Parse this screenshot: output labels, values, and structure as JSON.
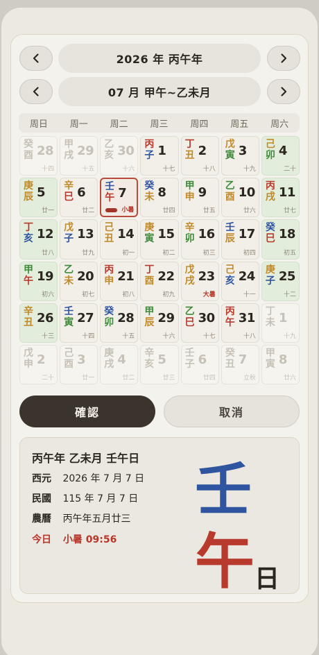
{
  "year_nav": {
    "title": "2026 年 丙午年"
  },
  "month_nav": {
    "title": "07 月 甲午~乙未月"
  },
  "weekdays": [
    "周日",
    "周一",
    "周二",
    "周三",
    "周四",
    "周五",
    "周六"
  ],
  "colors": {
    "wood": "#3f8a3a",
    "fire": "#b83a2c",
    "earth": "#c08a2a",
    "metal": "#a39a86",
    "water": "#2f55a0"
  },
  "days": [
    {
      "s": "癸",
      "b": "酉",
      "d": "28",
      "l": "十四",
      "muted": true
    },
    {
      "s": "甲",
      "b": "戌",
      "d": "29",
      "l": "十五",
      "muted": true
    },
    {
      "s": "乙",
      "b": "亥",
      "d": "30",
      "l": "十六",
      "muted": true
    },
    {
      "s": "丙",
      "b": "子",
      "d": "1",
      "l": "十七",
      "sc": "fire",
      "bc": "water"
    },
    {
      "s": "丁",
      "b": "丑",
      "d": "2",
      "l": "十八",
      "sc": "fire",
      "bc": "earth"
    },
    {
      "s": "戊",
      "b": "寅",
      "d": "3",
      "l": "十九",
      "sc": "earth",
      "bc": "wood"
    },
    {
      "s": "己",
      "b": "卯",
      "d": "4",
      "l": "二十",
      "sc": "earth",
      "bc": "wood"
    },
    {
      "s": "庚",
      "b": "辰",
      "d": "5",
      "l": "廿一",
      "sc": "earth",
      "bc": "earth"
    },
    {
      "s": "辛",
      "b": "巳",
      "d": "6",
      "l": "廿二",
      "sc": "earth",
      "bc": "fire"
    },
    {
      "s": "壬",
      "b": "午",
      "d": "7",
      "l": "小暑",
      "sc": "water",
      "bc": "fire",
      "selected": true,
      "term": true
    },
    {
      "s": "癸",
      "b": "未",
      "d": "8",
      "l": "廿四",
      "sc": "water",
      "bc": "earth"
    },
    {
      "s": "甲",
      "b": "申",
      "d": "9",
      "l": "廿五",
      "sc": "wood",
      "bc": "earth"
    },
    {
      "s": "乙",
      "b": "酉",
      "d": "10",
      "l": "廿六",
      "sc": "wood",
      "bc": "earth"
    },
    {
      "s": "丙",
      "b": "戌",
      "d": "11",
      "l": "廿七",
      "sc": "fire",
      "bc": "earth"
    },
    {
      "s": "丁",
      "b": "亥",
      "d": "12",
      "l": "廿八",
      "sc": "fire",
      "bc": "water"
    },
    {
      "s": "戊",
      "b": "子",
      "d": "13",
      "l": "廿九",
      "sc": "earth",
      "bc": "water"
    },
    {
      "s": "己",
      "b": "丑",
      "d": "14",
      "l": "初一",
      "sc": "earth",
      "bc": "earth"
    },
    {
      "s": "庚",
      "b": "寅",
      "d": "15",
      "l": "初二",
      "sc": "earth",
      "bc": "wood"
    },
    {
      "s": "辛",
      "b": "卯",
      "d": "16",
      "l": "初三",
      "sc": "earth",
      "bc": "wood"
    },
    {
      "s": "壬",
      "b": "辰",
      "d": "17",
      "l": "初四",
      "sc": "water",
      "bc": "earth"
    },
    {
      "s": "癸",
      "b": "巳",
      "d": "18",
      "l": "初五",
      "sc": "water",
      "bc": "fire"
    },
    {
      "s": "甲",
      "b": "午",
      "d": "19",
      "l": "初六",
      "sc": "wood",
      "bc": "fire"
    },
    {
      "s": "乙",
      "b": "未",
      "d": "20",
      "l": "初七",
      "sc": "wood",
      "bc": "earth"
    },
    {
      "s": "丙",
      "b": "申",
      "d": "21",
      "l": "初八",
      "sc": "fire",
      "bc": "earth"
    },
    {
      "s": "丁",
      "b": "酉",
      "d": "22",
      "l": "初九",
      "sc": "fire",
      "bc": "earth"
    },
    {
      "s": "戊",
      "b": "戌",
      "d": "23",
      "l": "大暑",
      "sc": "earth",
      "bc": "earth",
      "term": true
    },
    {
      "s": "己",
      "b": "亥",
      "d": "24",
      "l": "十一",
      "sc": "earth",
      "bc": "water"
    },
    {
      "s": "庚",
      "b": "子",
      "d": "25",
      "l": "十二",
      "sc": "earth",
      "bc": "water"
    },
    {
      "s": "辛",
      "b": "丑",
      "d": "26",
      "l": "十三",
      "sc": "earth",
      "bc": "earth"
    },
    {
      "s": "壬",
      "b": "寅",
      "d": "27",
      "l": "十四",
      "sc": "water",
      "bc": "wood"
    },
    {
      "s": "癸",
      "b": "卯",
      "d": "28",
      "l": "十五",
      "sc": "water",
      "bc": "wood"
    },
    {
      "s": "甲",
      "b": "辰",
      "d": "29",
      "l": "十六",
      "sc": "wood",
      "bc": "earth"
    },
    {
      "s": "乙",
      "b": "巳",
      "d": "30",
      "l": "十七",
      "sc": "wood",
      "bc": "fire"
    },
    {
      "s": "丙",
      "b": "午",
      "d": "31",
      "l": "十八",
      "sc": "fire",
      "bc": "fire"
    },
    {
      "s": "丁",
      "b": "未",
      "d": "1",
      "l": "十九",
      "muted": true
    },
    {
      "s": "戊",
      "b": "申",
      "d": "2",
      "l": "二十",
      "muted": true
    },
    {
      "s": "己",
      "b": "酉",
      "d": "3",
      "l": "廿一",
      "muted": true
    },
    {
      "s": "庚",
      "b": "戌",
      "d": "4",
      "l": "廿二",
      "muted": true
    },
    {
      "s": "辛",
      "b": "亥",
      "d": "5",
      "l": "廿三",
      "muted": true
    },
    {
      "s": "壬",
      "b": "子",
      "d": "6",
      "l": "廿四",
      "muted": true
    },
    {
      "s": "癸",
      "b": "丑",
      "d": "7",
      "l": "立秋",
      "muted": true
    },
    {
      "s": "甲",
      "b": "寅",
      "d": "8",
      "l": "廿六",
      "muted": true
    }
  ],
  "actions": {
    "confirm": "確認",
    "cancel": "取消"
  },
  "info": {
    "title": "丙午年 乙未月 壬午日",
    "gregorian_label": "西元",
    "gregorian_value": "2026 年 7 月 7 日",
    "minguo_label": "民國",
    "minguo_value": "115 年 7 月 7 日",
    "lunar_label": "農曆",
    "lunar_value": "丙午年五月廿三",
    "today_label": "今日",
    "today_value": "小暑 09:56",
    "big_stem": "壬",
    "big_branch": "午",
    "big_suffix": "日"
  }
}
